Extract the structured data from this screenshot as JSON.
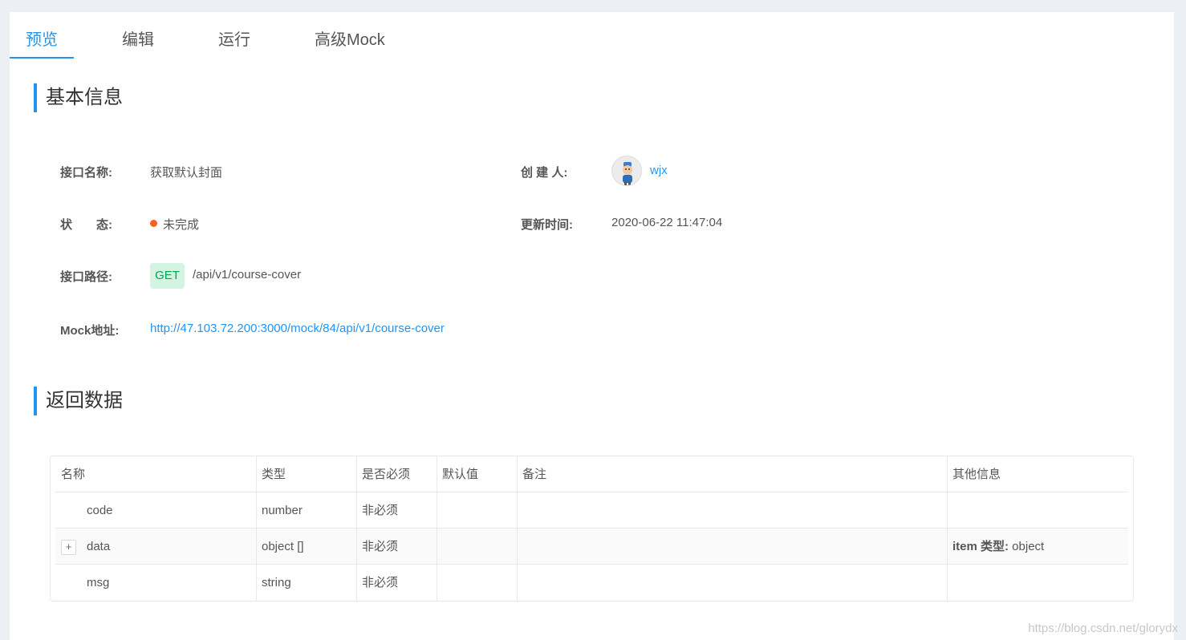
{
  "tabs": [
    {
      "label": "预览"
    },
    {
      "label": "编辑"
    },
    {
      "label": "运行"
    },
    {
      "label": "高级Mock"
    }
  ],
  "basic_info": {
    "section_title": "基本信息",
    "name_label": "接口名称:",
    "name_value": "获取默认封面",
    "creator_label": "创 建 人:",
    "creator_value": "wjx",
    "status_label": "状　　态:",
    "status_value": "未完成",
    "status_color": "#fd5e1c",
    "updated_label": "更新时间:",
    "updated_value": "2020-06-22 11:47:04",
    "path_label": "接口路径:",
    "method": "GET",
    "path_value": "/api/v1/course-cover",
    "mock_label": "Mock地址:",
    "mock_value": "http://47.103.72.200:3000/mock/84/api/v1/course-cover"
  },
  "response": {
    "section_title": "返回数据",
    "columns": [
      "名称",
      "类型",
      "是否必须",
      "默认值",
      "备注",
      "其他信息"
    ],
    "rows": [
      {
        "name": "code",
        "type": "number",
        "required": "非必须",
        "default": "",
        "note": "",
        "other_key": "",
        "other_val": ""
      },
      {
        "name": "data",
        "type": "object []",
        "required": "非必须",
        "default": "",
        "note": "",
        "other_key": "item 类型:",
        "other_val": " object",
        "expand": "+"
      },
      {
        "name": "msg",
        "type": "string",
        "required": "非必须",
        "default": "",
        "note": "",
        "other_key": "",
        "other_val": ""
      }
    ]
  },
  "watermark": "https://blog.csdn.net/glorydx",
  "accent_color": "#2395f1"
}
